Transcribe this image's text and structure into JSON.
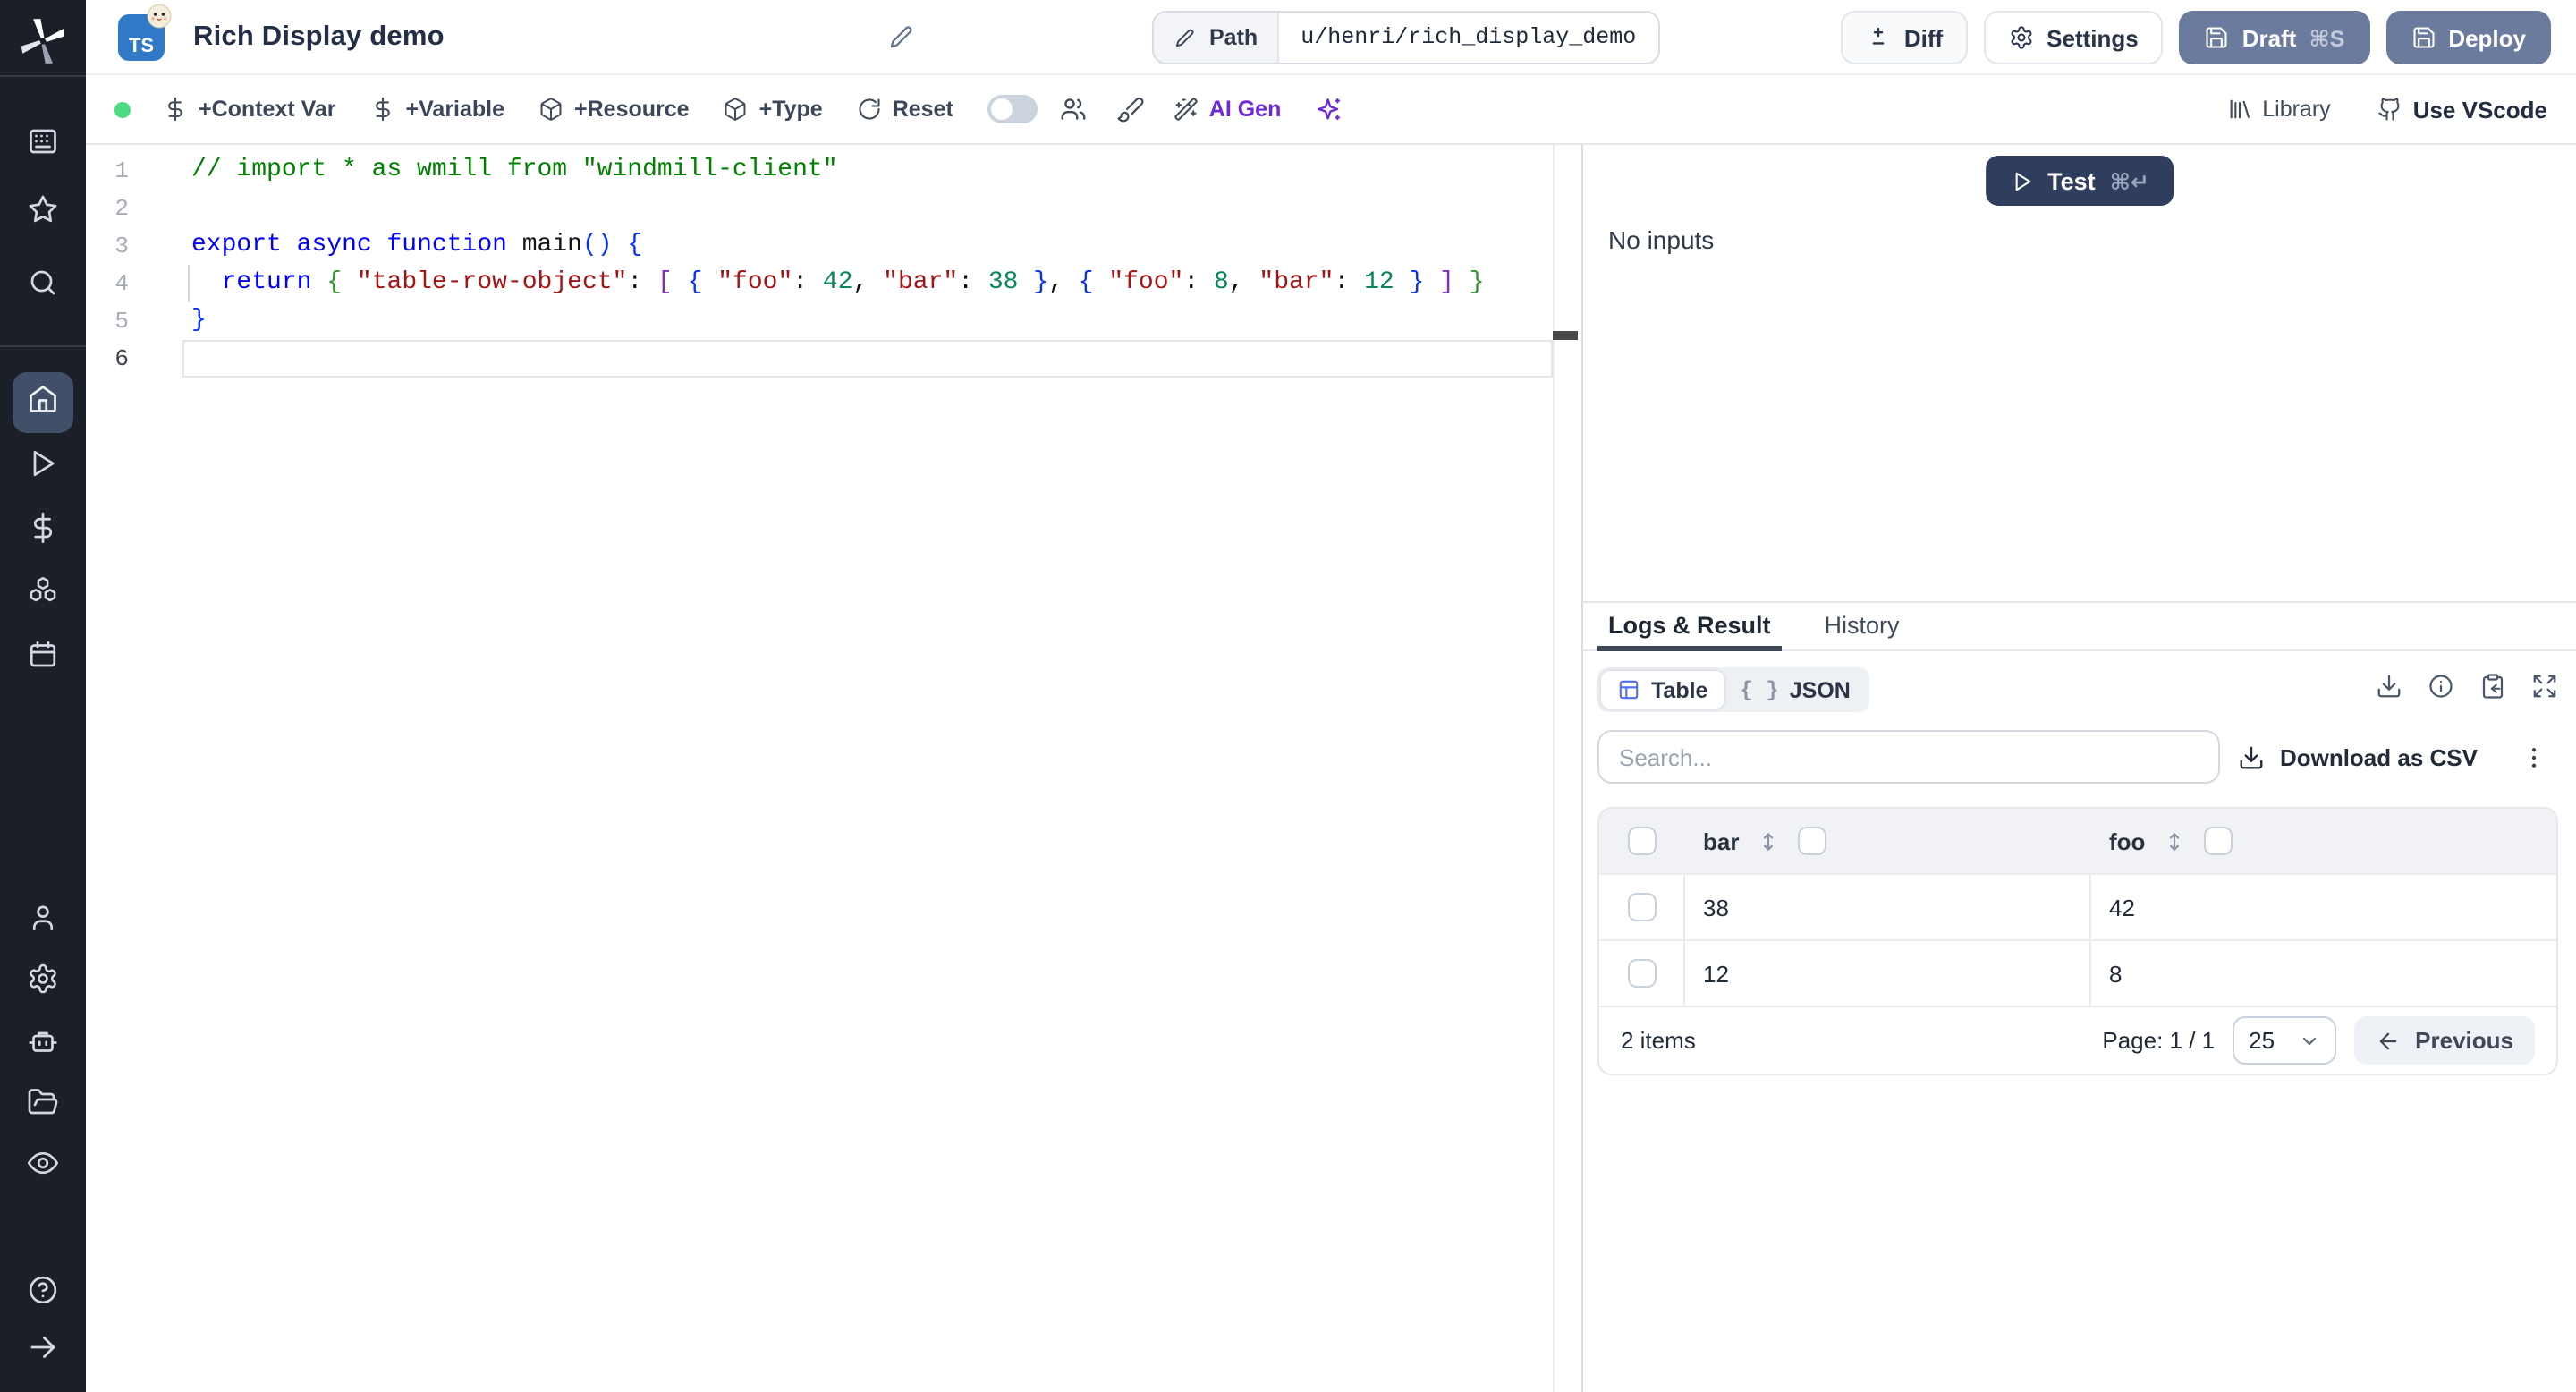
{
  "header": {
    "badge": "TS",
    "title": "Rich Display demo",
    "path_label": "Path",
    "path_value": "u/henri/rich_display_demo",
    "diff_label": "Diff",
    "settings_label": "Settings",
    "draft_label": "Draft",
    "draft_shortcut": "⌘S",
    "deploy_label": "Deploy"
  },
  "toolbar": {
    "context_var": "+Context Var",
    "variable": "+Variable",
    "resource": "+Resource",
    "type": "+Type",
    "reset": "Reset",
    "ai_gen": "AI Gen",
    "library": "Library",
    "use_vscode": "Use VScode"
  },
  "editor": {
    "lines": [
      {
        "tokens": [
          {
            "t": "// import * as wmill from \"windmill-client\"",
            "c": "cm"
          }
        ]
      },
      {
        "tokens": []
      },
      {
        "tokens": [
          {
            "t": "export",
            "c": "kw"
          },
          {
            "t": " ",
            "c": "pl"
          },
          {
            "t": "async",
            "c": "kw"
          },
          {
            "t": " ",
            "c": "pl"
          },
          {
            "t": "function",
            "c": "kw"
          },
          {
            "t": " ",
            "c": "pl"
          },
          {
            "t": "main",
            "c": "fn"
          },
          {
            "t": "(",
            "c": "b1"
          },
          {
            "t": ")",
            "c": "b1"
          },
          {
            "t": " ",
            "c": "pl"
          },
          {
            "t": "{",
            "c": "b1"
          }
        ]
      },
      {
        "tokens": [
          {
            "t": "  ",
            "c": "pl"
          },
          {
            "t": "return",
            "c": "kw"
          },
          {
            "t": " ",
            "c": "pl"
          },
          {
            "t": "{",
            "c": "b2"
          },
          {
            "t": " ",
            "c": "pl"
          },
          {
            "t": "\"table-row-object\"",
            "c": "str"
          },
          {
            "t": ":",
            "c": "pl"
          },
          {
            "t": " ",
            "c": "pl"
          },
          {
            "t": "[",
            "c": "b3"
          },
          {
            "t": " ",
            "c": "pl"
          },
          {
            "t": "{",
            "c": "b1"
          },
          {
            "t": " ",
            "c": "pl"
          },
          {
            "t": "\"foo\"",
            "c": "str"
          },
          {
            "t": ":",
            "c": "pl"
          },
          {
            "t": " ",
            "c": "pl"
          },
          {
            "t": "42",
            "c": "num"
          },
          {
            "t": ",",
            "c": "pl"
          },
          {
            "t": " ",
            "c": "pl"
          },
          {
            "t": "\"bar\"",
            "c": "str"
          },
          {
            "t": ":",
            "c": "pl"
          },
          {
            "t": " ",
            "c": "pl"
          },
          {
            "t": "38",
            "c": "num"
          },
          {
            "t": " ",
            "c": "pl"
          },
          {
            "t": "}",
            "c": "b1"
          },
          {
            "t": ",",
            "c": "pl"
          },
          {
            "t": " ",
            "c": "pl"
          },
          {
            "t": "{",
            "c": "b1"
          },
          {
            "t": " ",
            "c": "pl"
          },
          {
            "t": "\"foo\"",
            "c": "str"
          },
          {
            "t": ":",
            "c": "pl"
          },
          {
            "t": " ",
            "c": "pl"
          },
          {
            "t": "8",
            "c": "num"
          },
          {
            "t": ",",
            "c": "pl"
          },
          {
            "t": " ",
            "c": "pl"
          },
          {
            "t": "\"bar\"",
            "c": "str"
          },
          {
            "t": ":",
            "c": "pl"
          },
          {
            "t": " ",
            "c": "pl"
          },
          {
            "t": "12",
            "c": "num"
          },
          {
            "t": " ",
            "c": "pl"
          },
          {
            "t": "}",
            "c": "b1"
          },
          {
            "t": " ",
            "c": "pl"
          },
          {
            "t": "]",
            "c": "b3"
          },
          {
            "t": " ",
            "c": "pl"
          },
          {
            "t": "}",
            "c": "b2"
          }
        ]
      },
      {
        "tokens": [
          {
            "t": "}",
            "c": "b1"
          }
        ]
      },
      {
        "tokens": []
      }
    ]
  },
  "run_panel": {
    "test_label": "Test",
    "test_shortcut": "⌘↵",
    "empty_text": "No inputs"
  },
  "result_panel": {
    "tabs": [
      {
        "label": "Logs & Result"
      },
      {
        "label": "History"
      }
    ],
    "view_toggle": {
      "table_label": "Table",
      "json_label": "JSON",
      "braces_icon": "{ }"
    },
    "search_placeholder": "Search...",
    "download_csv_label": "Download as CSV",
    "table": {
      "columns": [
        "bar",
        "foo"
      ],
      "rows": [
        {
          "bar": "38",
          "foo": "42"
        },
        {
          "bar": "12",
          "foo": "8"
        }
      ],
      "items_label": "2 items",
      "page_label": "Page: 1 / 1",
      "page_size": "25",
      "previous_label": "Previous"
    }
  },
  "colors": {
    "draft_deploy_button": "#6a7b9d",
    "test_button": "#2f3e5c",
    "ai_purple": "#6d28d9",
    "valid_green": "#4ade80",
    "ts_badge_blue": "#3178c6",
    "sidebar_bg": "#1b1f28",
    "sidebar_active_bg": "#414f69"
  }
}
